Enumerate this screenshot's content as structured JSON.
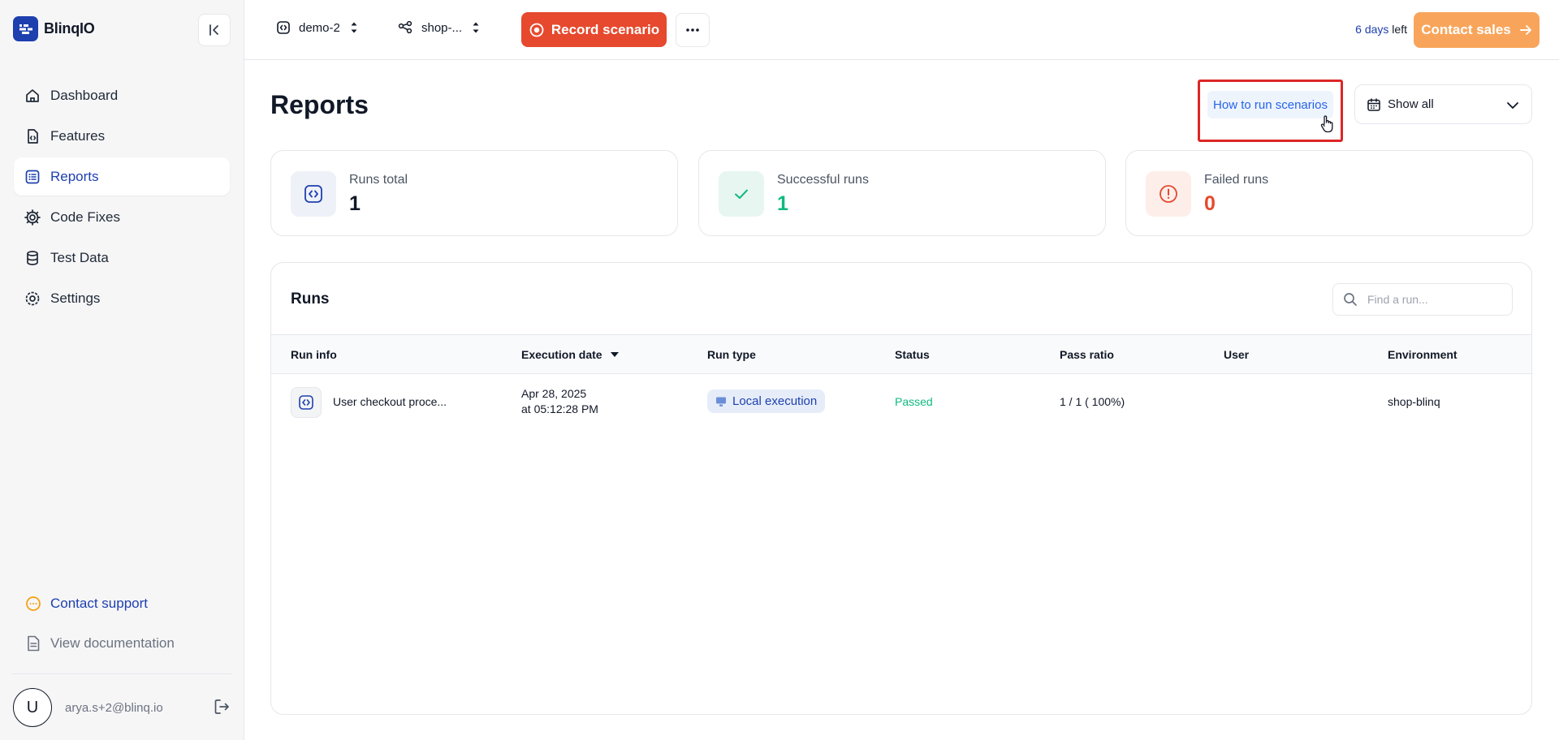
{
  "brand": {
    "name": "BlinqIO"
  },
  "sidebar": {
    "items": [
      {
        "label": "Dashboard",
        "icon": "home-icon"
      },
      {
        "label": "Features",
        "icon": "file-code-icon"
      },
      {
        "label": "Reports",
        "icon": "list-icon",
        "active": true
      },
      {
        "label": "Code Fixes",
        "icon": "gear-icon"
      },
      {
        "label": "Test Data",
        "icon": "database-icon"
      },
      {
        "label": "Settings",
        "icon": "settings-icon"
      }
    ],
    "support_label": "Contact support",
    "docs_label": "View documentation",
    "user": {
      "initial": "U",
      "email": "arya.s+2@blinq.io"
    }
  },
  "topbar": {
    "project": "demo-2",
    "environment": "shop-...",
    "record_label": "Record scenario",
    "trial_days": "6 days",
    "trial_suffix": " left",
    "contact_label": "Contact sales"
  },
  "page": {
    "title": "Reports",
    "howto_label": "How to run scenarios",
    "filter_label": "Show all"
  },
  "stats": [
    {
      "label": "Runs total",
      "value": "1",
      "color": "#111827"
    },
    {
      "label": "Successful runs",
      "value": "1",
      "color": "#10b981"
    },
    {
      "label": "Failed runs",
      "value": "0",
      "color": "#e6492d"
    }
  ],
  "runs": {
    "title": "Runs",
    "search_placeholder": "Find a run...",
    "columns": [
      "Run info",
      "Execution date",
      "Run type",
      "Status",
      "Pass ratio",
      "User",
      "Environment"
    ],
    "rows": [
      {
        "name": "User checkout proce...",
        "date_line1": "Apr 28, 2025",
        "date_line2": "at 05:12:28 PM",
        "run_type": "Local execution",
        "status": "Passed",
        "pass_ratio": "1 / 1 ( 100%)",
        "user": "",
        "environment": "shop-blinq"
      }
    ]
  },
  "colors": {
    "accent": "#1e40af",
    "record": "#e6492d",
    "contact": "#f8a55b",
    "success": "#10b981"
  }
}
